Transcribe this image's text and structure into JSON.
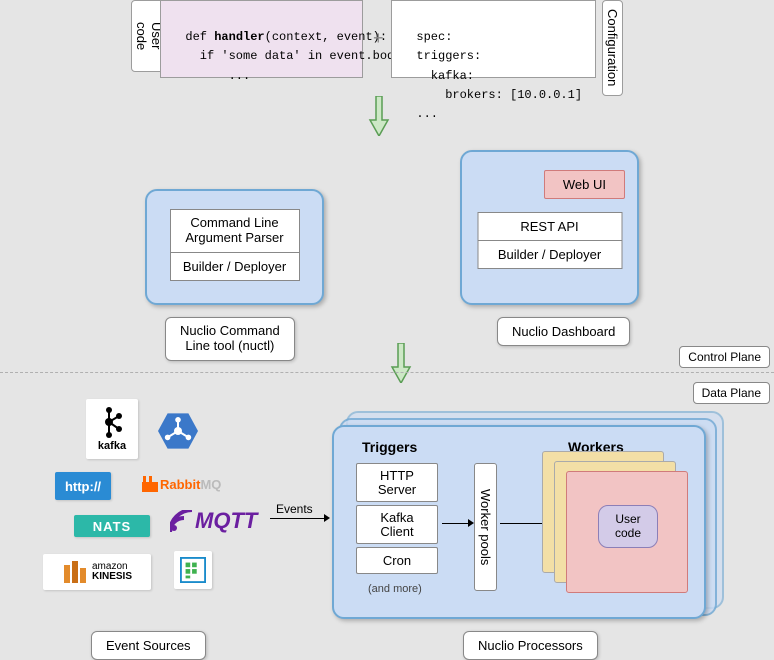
{
  "labels": {
    "user_code_vlabel": "User code",
    "configuration_vlabel": "Configuration"
  },
  "code": {
    "user": "def handler(context, event):\n    if 'some data' in event.body:\n        ...",
    "spec": "spec:\n  triggers:\n    kafka:\n      brokers: [10.0.0.1]\n  ..."
  },
  "cli_panel": {
    "row1": "Command Line",
    "row1b": "Argument Parser",
    "row2": "Builder / Deployer",
    "caption1": "Nuclio Command",
    "caption2": "Line tool (nuctl)"
  },
  "dash_panel": {
    "webui": "Web UI",
    "row1": "REST API",
    "row2": "Builder / Deployer",
    "caption": "Nuclio Dashboard"
  },
  "planes": {
    "control": "Control Plane",
    "data": "Data Plane"
  },
  "sources": {
    "kafka": "kafka",
    "http": "http://",
    "rabbit_prefix": "Rabbit",
    "rabbit_suffix": "MQ",
    "nats": "NATS",
    "mqtt": "MQTT",
    "amazon1": "amazon",
    "amazon2": "KINESIS",
    "caption": "Event Sources"
  },
  "events_label": "Events",
  "processor": {
    "triggers_title": "Triggers",
    "workers_title": "Workers",
    "t_http1": "HTTP",
    "t_http2": "Server",
    "t_kafka1": "Kafka",
    "t_kafka2": "Client",
    "t_cron": "Cron",
    "and_more": "(and more)",
    "worker_pools": "Worker pools",
    "user_code1": "User",
    "user_code2": "code",
    "caption": "Nuclio Processors"
  }
}
